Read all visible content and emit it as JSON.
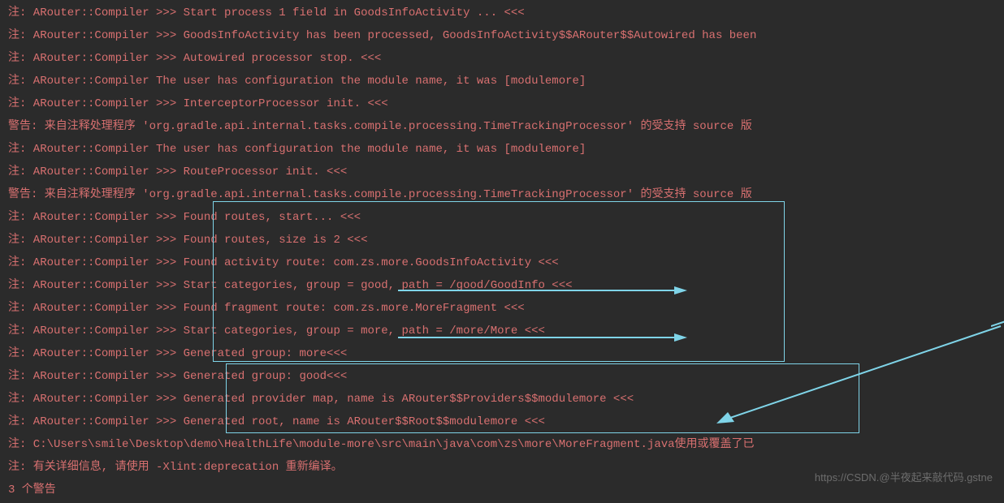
{
  "lines": [
    "注: ARouter::Compiler >>> Start process 1 field in GoodsInfoActivity ... <<<",
    "注: ARouter::Compiler >>> GoodsInfoActivity has been processed, GoodsInfoActivity$$ARouter$$Autowired has been",
    "注: ARouter::Compiler >>> Autowired processor stop. <<<",
    "注: ARouter::Compiler The user has configuration the module name, it was [modulemore]",
    "注: ARouter::Compiler >>> InterceptorProcessor init. <<<",
    "警告: 来自注释处理程序 'org.gradle.api.internal.tasks.compile.processing.TimeTrackingProcessor' 的受支持 source 版",
    "注: ARouter::Compiler The user has configuration the module name, it was [modulemore]",
    "注: ARouter::Compiler >>> RouteProcessor init. <<<",
    "警告: 来自注释处理程序 'org.gradle.api.internal.tasks.compile.processing.TimeTrackingProcessor' 的受支持 source 版",
    "注: ARouter::Compiler >>> Found routes, start... <<<",
    "注: ARouter::Compiler >>> Found routes, size is 2 <<<",
    "注: ARouter::Compiler >>> Found activity route: com.zs.more.GoodsInfoActivity <<<",
    "注: ARouter::Compiler >>> Start categories, group = good, path = /good/GoodInfo <<<",
    "注: ARouter::Compiler >>> Found fragment route: com.zs.more.MoreFragment <<<",
    "注: ARouter::Compiler >>> Start categories, group = more, path = /more/More <<<",
    "注: ARouter::Compiler >>> Generated group: more<<<",
    "注: ARouter::Compiler >>> Generated group: good<<<",
    "注: ARouter::Compiler >>> Generated provider map, name is ARouter$$Providers$$modulemore <<<",
    "注: ARouter::Compiler >>> Generated root, name is ARouter$$Root$$modulemore <<<",
    "注: C:\\Users\\smile\\Desktop\\demo\\HealthLife\\module-more\\src\\main\\java\\com\\zs\\more\\MoreFragment.java使用或覆盖了已",
    "注: 有关详细信息, 请使用 -Xlint:deprecation 重新编译。",
    "3 个警告"
  ],
  "watermark": "https://CSDN.@半夜起来敲代码.gstne"
}
